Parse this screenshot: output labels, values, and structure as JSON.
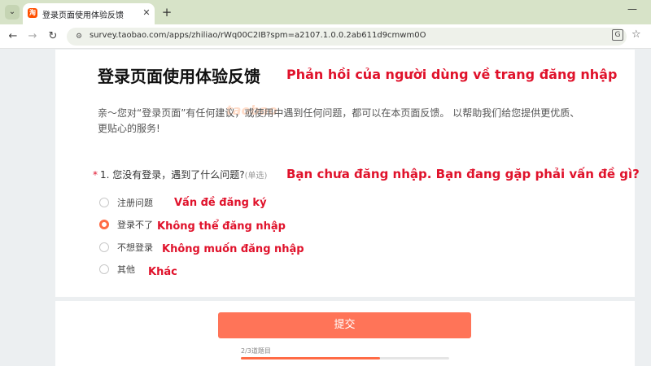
{
  "browser": {
    "tab_title": "登录页面使用体验反馈",
    "favicon_text": "淘",
    "url": "survey.taobao.com/apps/zhiliao/rWq00C2IB?spm=a2107.1.0.0.2ab611d9cmwm0O",
    "icons": {
      "tab_list": "chevron-down-icon",
      "close": "close-icon",
      "new_tab": "plus-icon",
      "minimize": "minimize-icon",
      "back": "arrow-left-icon",
      "forward": "arrow-right-icon",
      "reload": "reload-icon",
      "site_info": "tune-icon",
      "translate": "translate-icon",
      "bookmark": "star-icon"
    }
  },
  "survey": {
    "title": "登录页面使用体验反馈",
    "title_translation": "Phản hồi của người dùng về trang đăng nhập",
    "watermark": "taobao",
    "intro": "亲～您对“登录页面”有任何建议，或使用中遇到任何问题，都可以在本页面反馈。 以帮助我们给您提供更优质、更贴心的服务!",
    "question": {
      "required_mark": "*",
      "text": "1. 您没有登录，遇到了什么问题?",
      "type": "(单选)",
      "translation": "Bạn chưa đăng nhập. Bạn đang gặp phải vấn đề gì?",
      "options": [
        {
          "label": "注册问题",
          "translation": "Vấn đề đăng ký",
          "checked": false
        },
        {
          "label": "登录不了",
          "translation": "Không thể đăng nhập",
          "checked": true
        },
        {
          "label": "不想登录",
          "translation": "Không muốn đăng nhập",
          "checked": false
        },
        {
          "label": "其他",
          "translation": "Khác",
          "checked": false
        }
      ]
    },
    "submit_label": "提交",
    "progress": {
      "text": "2/3道题目",
      "fraction": 0.667
    }
  },
  "colors": {
    "accent": "#ff6b45",
    "submit_bg": "#ff7458",
    "translation_red": "#e0122b",
    "tabbar_bg": "#d7e3c8"
  }
}
